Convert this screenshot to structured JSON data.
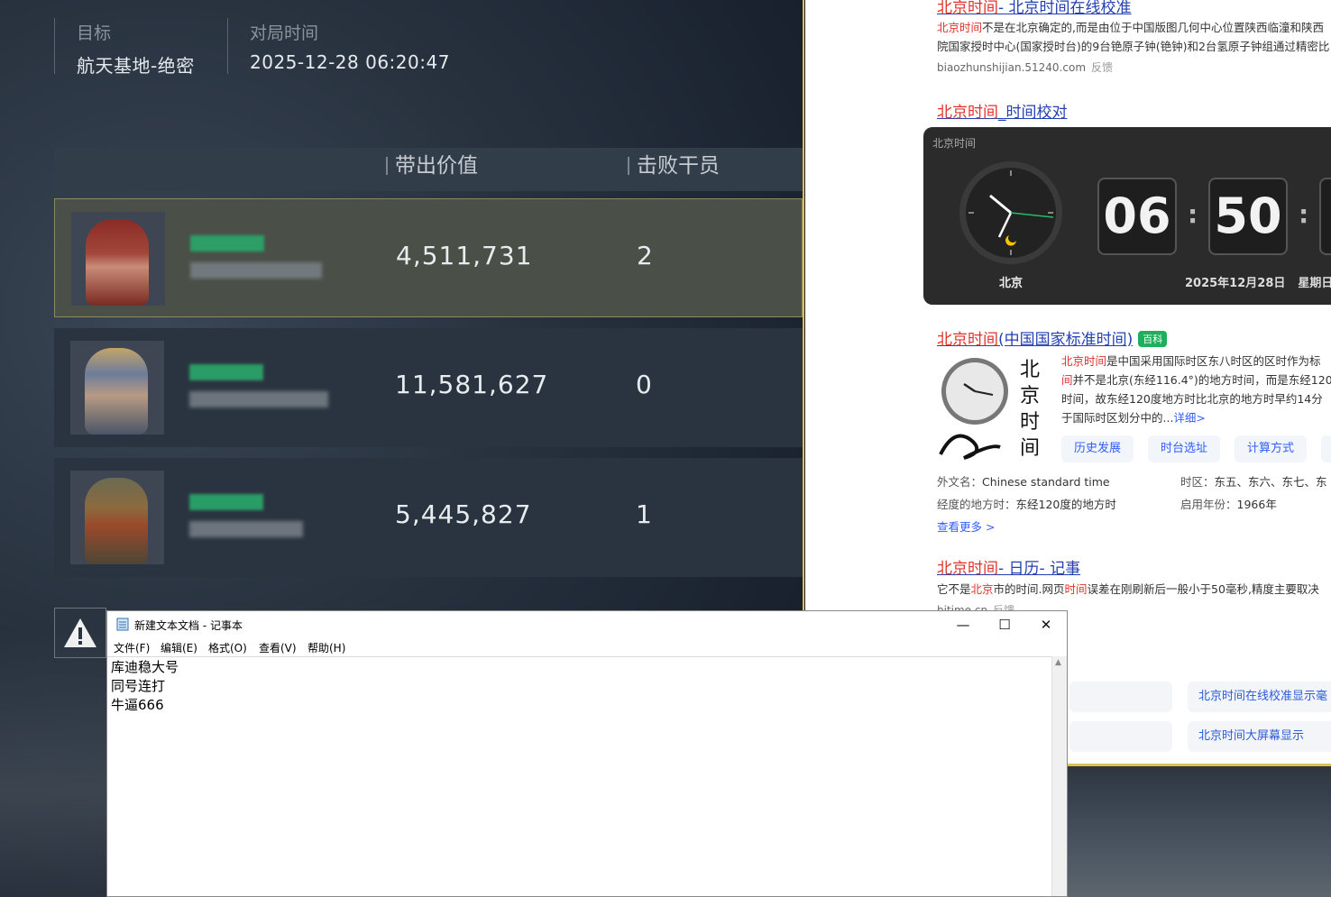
{
  "game": {
    "target_label": "目标",
    "target_value": "航天基地-绝密",
    "time_label": "对局时间",
    "time_value": "2025-12-28 06:20:47",
    "col_value": "带出价值",
    "col_kills": "击败干员",
    "rows": [
      {
        "value": "4,511,731",
        "kills": "2",
        "selected": true
      },
      {
        "value": "11,581,627",
        "kills": "0",
        "selected": false
      },
      {
        "value": "5,445,827",
        "kills": "1",
        "selected": false
      }
    ],
    "warning_icon": "warning-triangle-icon"
  },
  "browser": {
    "result1": {
      "title_hl": "北京时间",
      "title_rest": "- 北京时间在线校准",
      "snip1_hl": "北京时间",
      "snip1_rest": "不是在北京确定的,而是由位于中国版图几何中心位置陕西临潼和陕西",
      "snip2": "院国家授时中心(国家授时台)的9台铯原子钟(铯钟)和2台氢原子钟组通过精密比",
      "src": "biaozhunshijian.51240.com",
      "feedback": "反馈"
    },
    "result2": {
      "title_hl": "北京时间",
      "title_rest": "_时间校对"
    },
    "clock": {
      "label": "北京时间",
      "city": "北京",
      "hour": "06",
      "minute": "50",
      "date": "2025年12月28日",
      "weekday": "星期日"
    },
    "result3": {
      "title_hl": "北京时间",
      "title_rest": "(中国国家标准时间)",
      "badge": "百科",
      "image_text": "北京时间",
      "line1_hl": "北京时间",
      "line1_rest": "是中国采用国际时区东八时区的区时作为标",
      "line2_hl": "间",
      "line2_rest": "并不是北京(东经116.4°)的地方时间，而是东经120",
      "line3": "时间，故东经120度地方时比北京的地方时早约14分",
      "line4": "于国际时区划分中的...",
      "detail": "详细>",
      "tags": [
        "历史发展",
        "时台选址",
        "计算方式"
      ],
      "foreign_label": "外文名：",
      "foreign_value": "Chinese standard time",
      "zone_label": "时区：",
      "zone_value": "东五、东六、东七、东",
      "lon_label": "经度的地方时：",
      "lon_value": "东经120度的地方时",
      "year_label": "启用年份：",
      "year_value": "1966年",
      "more": "查看更多 >"
    },
    "result4": {
      "title_hl": "北京时间",
      "title_rest": "- 日历- 记事",
      "snip_a": "它不是",
      "snip_hl1": "北京",
      "snip_b": "市的时间.网页",
      "snip_hl2": "时间",
      "snip_c": "误差在刚刷新后一般小于50毫秒,精度主要取决",
      "src": "bjtime.cn",
      "feedback": "反馈"
    },
    "related": [
      "北京时间在线校准显示毫",
      "北京时间大屏幕显示"
    ]
  },
  "notepad": {
    "title": "新建文本文档 - 记事本",
    "menu": [
      "文件(F)",
      "编辑(E)",
      "格式(O)",
      "查看(V)",
      "帮助(H)"
    ],
    "lines": [
      "库迪稳大号",
      "同号连打",
      "牛逼666"
    ]
  }
}
